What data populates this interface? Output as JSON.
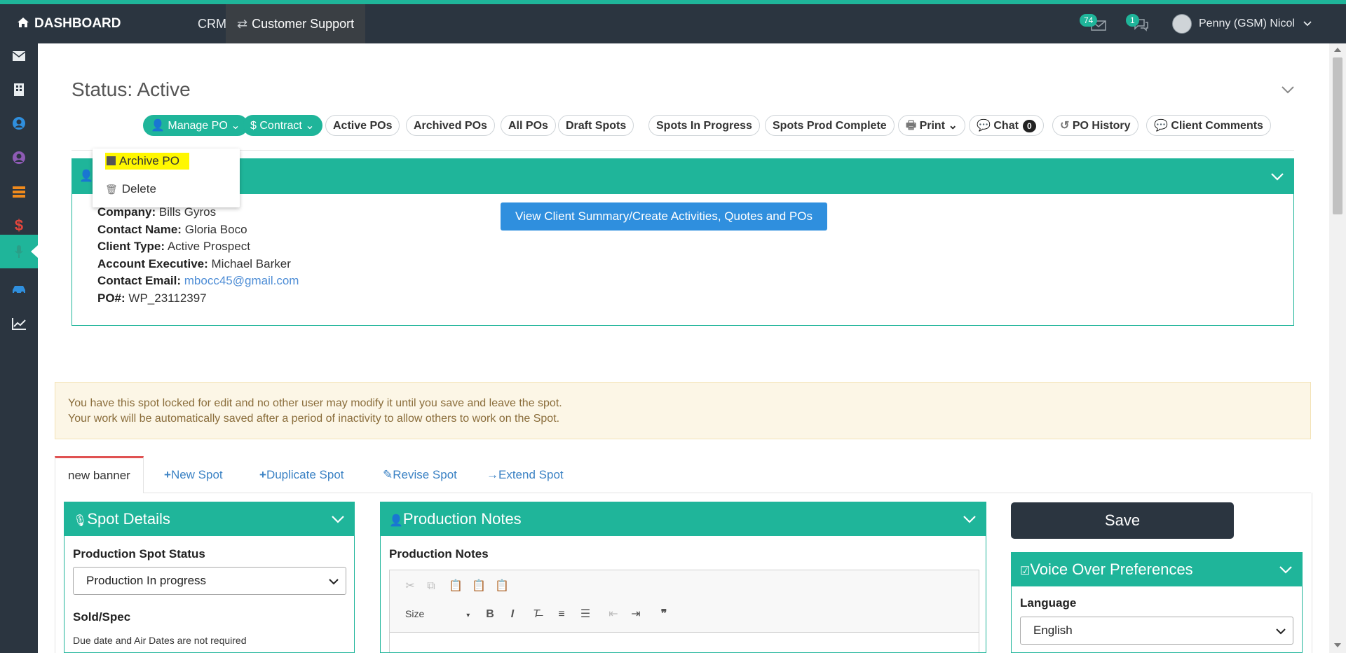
{
  "topbar": {
    "brand": "DASHBOARD",
    "nav_crm": "CRM",
    "nav_customer_support": "Customer Support",
    "mail_badge": "74",
    "chat_badge": "1",
    "user_name": "Penny (GSM) Nicol"
  },
  "page": {
    "status_title": "Status: Active"
  },
  "actions": {
    "manage_po": "Manage PO",
    "contract": "Contract",
    "active_pos": "Active POs",
    "archived_pos": "Archived POs",
    "all_pos": "All POs",
    "draft_spots": "Draft Spots",
    "spots_in_progress": "Spots In Progress",
    "spots_prod_complete": "Spots Prod Complete",
    "print": "Print",
    "chat": "Chat",
    "chat_count": "0",
    "po_history": "PO History",
    "client_comments": "Client Comments"
  },
  "manage_menu": {
    "archive": "Archive PO",
    "delete": "Delete"
  },
  "client": {
    "company_label": "Company:",
    "company": "Bills Gyros",
    "contact_label": "Contact Name:",
    "contact": "Gloria Boco",
    "type_label": "Client Type:",
    "type": "Active Prospect",
    "ae_label": "Account Executive:",
    "ae": "Michael Barker",
    "email_label": "Contact Email:",
    "email": "mbocc45@gmail.com",
    "po_label": "PO#:",
    "po": "WP_23112397",
    "summary_button": "View Client Summary/Create Activities, Quotes and POs"
  },
  "alert": {
    "line1": "You have this spot locked for edit and no other user may modify it until you save and leave the spot.",
    "line2": "Your work will be automatically saved after a period of inactivity to allow others to work on the Spot."
  },
  "tabs": {
    "active": "new banner",
    "new_spot": "New Spot",
    "duplicate_spot": "Duplicate Spot",
    "revise_spot": "Revise Spot",
    "extend_spot": "Extend Spot"
  },
  "spot_details": {
    "title": "Spot Details",
    "status_label": "Production Spot Status",
    "status_value": "Production In progress",
    "sold_label": "Sold/Spec",
    "sold_helper": "Due date and Air Dates are not required"
  },
  "production_notes": {
    "title": "Production Notes",
    "label": "Production Notes",
    "size_label": "Size"
  },
  "save_button": "Save",
  "voice_over": {
    "title": "Voice Over Preferences",
    "language_label": "Language",
    "language_value": "English"
  },
  "colors": {
    "accent": "#1fb59a",
    "topbar": "#2b3540",
    "primary_button": "#2f8fde",
    "highlight": "#fff700"
  }
}
